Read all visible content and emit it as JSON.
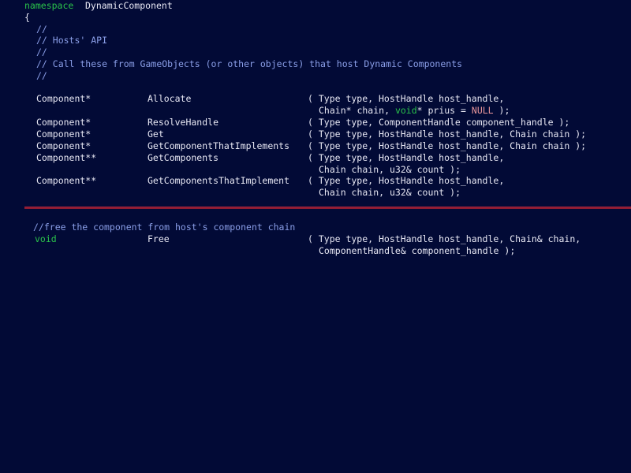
{
  "editor": {
    "background_color": "#020a36",
    "default_text_color": "#e8e8f4",
    "keyword_color": "#2ac34a",
    "comment_color": "#8b9fe8",
    "constant_color": "#e8959a",
    "separator_color": "#8e1b32",
    "language": "C++"
  },
  "code": {
    "namespace_keyword": "namespace",
    "namespace_name": "DynamicComponent",
    "open_brace": "{",
    "comment_bar_1": "//",
    "comment_hosts_api": "// Hosts' API",
    "comment_bar_2": "//",
    "comment_call_these": "// Call these from GameObjects (or other objects) that host Dynamic Components",
    "comment_bar_3": "//",
    "comment_free": "//free the component from host's component chain"
  },
  "declarations": [
    {
      "return_type": "Component*",
      "name": "Allocate",
      "args_line_1": "( Type type, HostHandle host_handle,",
      "args_line_2": "Chain* chain, ",
      "args_line_2_kw": "void",
      "args_line_2_tail": "* prius = ",
      "args_line_2_const": "NULL",
      "args_line_2_end": " );"
    },
    {
      "return_type": "Component*",
      "name": "ResolveHandle",
      "args_line_1": "( Type type, ComponentHandle component_handle );"
    },
    {
      "return_type": "Component*",
      "name": "Get",
      "args_line_1": "( Type type, HostHandle host_handle, Chain chain );"
    },
    {
      "return_type": "Component*",
      "name": "GetComponentThatImplements",
      "args_line_1": "( Type type, HostHandle host_handle, Chain chain );"
    },
    {
      "return_type": "Component**",
      "name": "GetComponents",
      "args_line_1": "( Type type, HostHandle host_handle,",
      "args_line_2": "Chain chain, u32& count );"
    },
    {
      "return_type": "Component**",
      "name": "GetComponentsThatImplement",
      "args_line_1": "( Type type, HostHandle host_handle,",
      "args_line_2": "Chain chain, u32& count );"
    }
  ],
  "free_declaration": {
    "return_type": "void",
    "name": "Free",
    "args_line_1": "( Type type, HostHandle host_handle, Chain& chain,",
    "args_line_2": "ComponentHandle& component_handle );"
  }
}
